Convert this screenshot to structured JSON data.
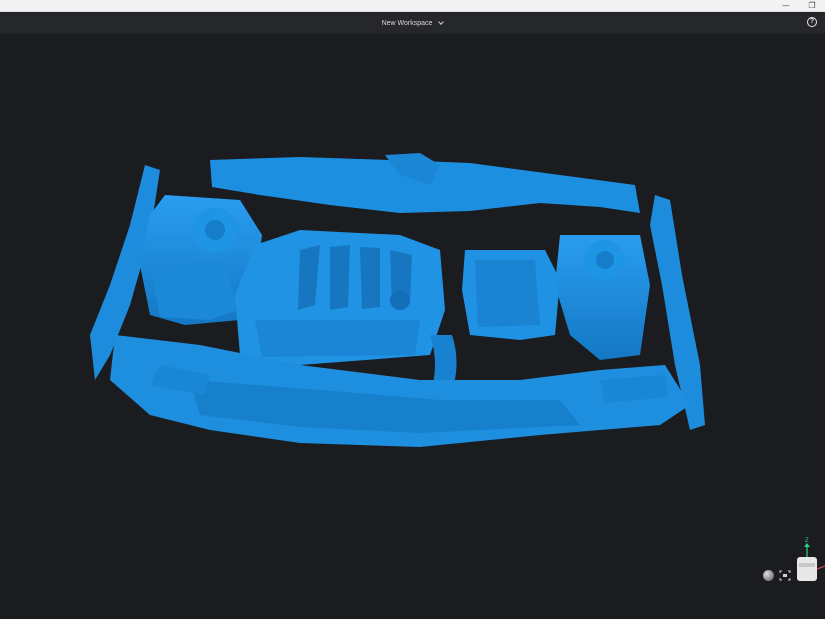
{
  "window": {
    "minimize_glyph": "—",
    "maximize_glyph": "❐"
  },
  "header": {
    "workspace_title": "New Workspace",
    "help_glyph": "?"
  },
  "viewport": {
    "model_color": "#1c8fde",
    "background_color": "#1b1c1f",
    "axis_z_label": "Z",
    "axis_z_color": "#2ed18a",
    "axis_x_color": "#e04a4a"
  }
}
